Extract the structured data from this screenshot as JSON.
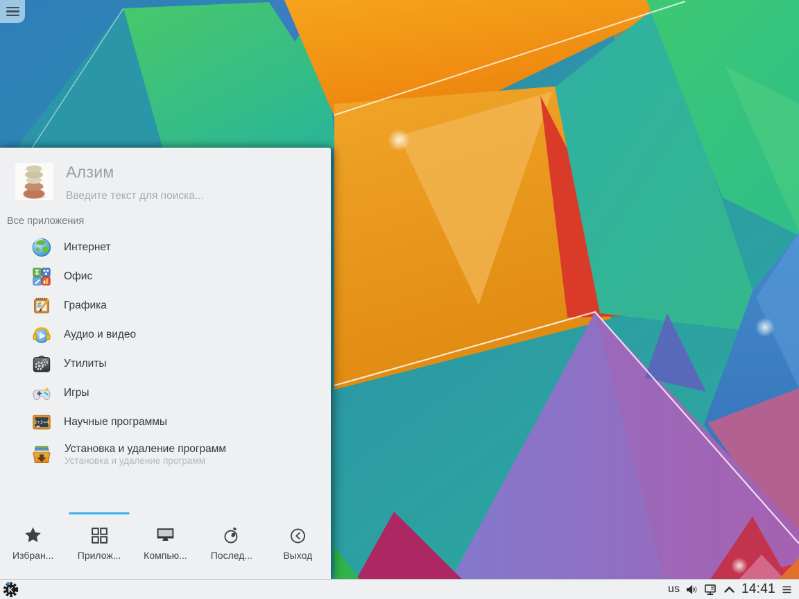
{
  "desktop": {
    "toolbox_icon": "hamburger-icon"
  },
  "launcher": {
    "user_name": "Алзим",
    "search_placeholder": "Введите текст для поиска...",
    "breadcrumb": "Все приложения",
    "items": [
      {
        "label": "Интернет",
        "icon": "globe-icon"
      },
      {
        "label": "Офис",
        "icon": "office-icon"
      },
      {
        "label": "Графика",
        "icon": "graphics-icon"
      },
      {
        "label": "Аудио и видео",
        "icon": "multimedia-icon"
      },
      {
        "label": "Утилиты",
        "icon": "utilities-icon"
      },
      {
        "label": "Игры",
        "icon": "gamepad-icon"
      },
      {
        "label": "Научные программы",
        "icon": "science-icon"
      },
      {
        "label": "Установка и удаление программ",
        "sublabel": "Установка и удаление программ",
        "icon": "software-install-icon"
      }
    ],
    "tabs": [
      {
        "label": "Избран...",
        "icon": "star-icon",
        "active": false
      },
      {
        "label": "Прилож...",
        "icon": "apps-grid-icon",
        "active": true
      },
      {
        "label": "Компью...",
        "icon": "computer-icon",
        "active": false
      },
      {
        "label": "Послед...",
        "icon": "history-icon",
        "active": false
      },
      {
        "label": "Выход",
        "icon": "leave-icon",
        "active": false
      }
    ]
  },
  "taskbar": {
    "keyboard_layout": "us",
    "clock": "14:41",
    "tray_icons": [
      "volume-icon",
      "display-icon",
      "expand-tray-icon",
      "panel-menu-icon"
    ]
  },
  "colors": {
    "accent": "#3daee9",
    "panel_bg": "#eff0f1",
    "taskbar_bg": "#eef0f1",
    "item_text": "#33383c",
    "muted_text": "#9aa0a4"
  }
}
